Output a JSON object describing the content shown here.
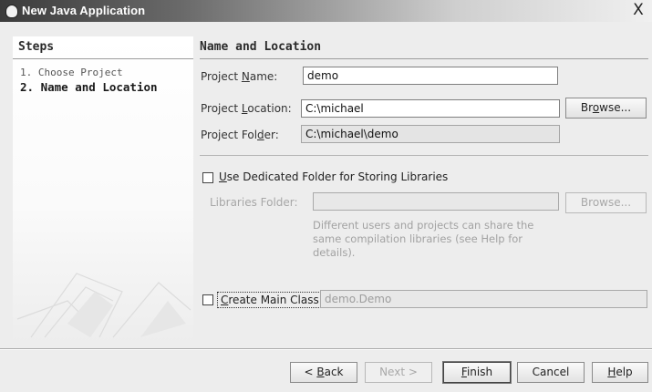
{
  "window": {
    "title": "New Java Application",
    "close_label": "X"
  },
  "sidebar": {
    "title": "Steps",
    "steps": [
      {
        "number": "1.",
        "label": "Choose Project"
      },
      {
        "number": "2.",
        "label": "Name and Location"
      }
    ]
  },
  "main": {
    "section_title": "Name and Location",
    "project_name": {
      "label_pre": "Project ",
      "label_mnemonic": "N",
      "label_post": "ame:",
      "value": "demo"
    },
    "project_location": {
      "label_pre": "Project ",
      "label_mnemonic": "L",
      "label_post": "ocation:",
      "value": "C:\\michael"
    },
    "project_folder": {
      "label_pre": "Project Fol",
      "label_mnemonic": "d",
      "label_post": "er:",
      "value": "C:\\michael\\demo"
    },
    "browse_label_pre": "Br",
    "browse_label_mnemonic": "o",
    "browse_label_post": "wse...",
    "dedicated_folder": {
      "mnemonic": "U",
      "label_rest": "se Dedicated Folder for Storing Libraries",
      "checked": false
    },
    "libraries_folder": {
      "label": "Libraries Folder:",
      "value": ""
    },
    "browse2_label": "Browse...",
    "hint": "Different users and projects can share the same compilation libraries (see Help for details).",
    "create_main_class": {
      "mnemonic": "C",
      "label_rest": "reate Main Class",
      "checked": false,
      "value": "demo.Demo"
    }
  },
  "footer": {
    "back": {
      "pre": "< ",
      "mnemonic": "B",
      "post": "ack"
    },
    "next": "Next >",
    "finish": {
      "mnemonic": "F",
      "post": "inish"
    },
    "cancel": "Cancel",
    "help": {
      "mnemonic": "H",
      "post": "elp"
    }
  }
}
